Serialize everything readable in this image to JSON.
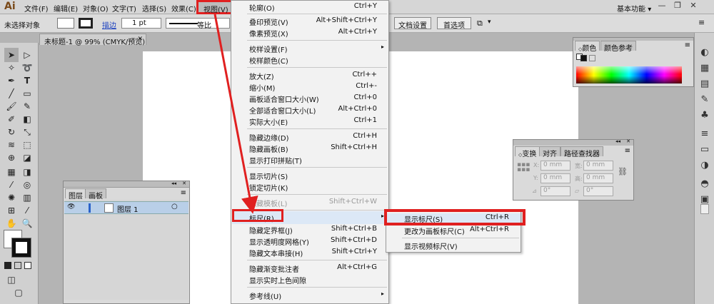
{
  "app": {
    "logo": "Ai",
    "workspace": "基本功能",
    "workspace_arrow": "▾"
  },
  "menubar": {
    "items": [
      {
        "label": "文件(F)"
      },
      {
        "label": "编辑(E)"
      },
      {
        "label": "对象(O)"
      },
      {
        "label": "文字(T)"
      },
      {
        "label": "选择(S)"
      },
      {
        "label": "效果(C)"
      }
    ],
    "view": "视图(V)"
  },
  "window_controls": {
    "minimize": "—",
    "restore": "❐",
    "close": "✕"
  },
  "controlbar": {
    "selection": "未选择对象",
    "stroke_label": "描边",
    "stroke_weight": "1 pt",
    "stroke_profile": "等比",
    "doc_setup": "文档设置",
    "preferences": "首选项"
  },
  "document_tab": {
    "title": "未标题-1 @ 99% (CMYK/预览)",
    "close": "✕"
  },
  "view_menu": {
    "items": [
      {
        "label": "轮廓(O)",
        "shortcut": "Ctrl+Y"
      },
      {
        "label": "叠印预览(V)",
        "shortcut": "Alt+Shift+Ctrl+Y"
      },
      {
        "label": "像素预览(X)",
        "shortcut": "Alt+Ctrl+Y"
      },
      {
        "label": "校样设置(F)",
        "shortcut": "",
        "submenu": true
      },
      {
        "label": "校样颜色(C)",
        "shortcut": ""
      },
      {
        "label": "放大(Z)",
        "shortcut": "Ctrl++"
      },
      {
        "label": "缩小(M)",
        "shortcut": "Ctrl+-"
      },
      {
        "label": "画板适合窗口大小(W)",
        "shortcut": "Ctrl+0"
      },
      {
        "label": "全部适合窗口大小(L)",
        "shortcut": "Alt+Ctrl+0"
      },
      {
        "label": "实际大小(E)",
        "shortcut": "Ctrl+1"
      },
      {
        "label": "隐藏边缘(D)",
        "shortcut": "Ctrl+H"
      },
      {
        "label": "隐藏画板(B)",
        "shortcut": "Shift+Ctrl+H"
      },
      {
        "label": "显示打印拼贴(T)",
        "shortcut": ""
      },
      {
        "label": "显示切片(S)",
        "shortcut": ""
      },
      {
        "label": "锁定切片(K)",
        "shortcut": ""
      },
      {
        "label": "隐藏模板(L)",
        "shortcut": "Shift+Ctrl+W",
        "disabled": true
      },
      {
        "label": "标尺(R)",
        "shortcut": "",
        "submenu": true
      },
      {
        "label": "隐藏定界框(J)",
        "shortcut": "Shift+Ctrl+B"
      },
      {
        "label": "显示透明度网格(Y)",
        "shortcut": "Shift+Ctrl+D"
      },
      {
        "label": "隐藏文本串接(H)",
        "shortcut": "Shift+Ctrl+Y"
      },
      {
        "label": "隐藏渐变批注者",
        "shortcut": "Alt+Ctrl+G"
      },
      {
        "label": "显示实时上色间隙",
        "shortcut": ""
      },
      {
        "label": "参考线(U)",
        "shortcut": "",
        "submenu": true
      }
    ],
    "submenu_arrow": "▸"
  },
  "ruler_submenu": {
    "items": [
      {
        "label": "显示标尺(S)",
        "shortcut": "Ctrl+R"
      },
      {
        "label": "更改为画板标尺(C)",
        "shortcut": "Alt+Ctrl+R"
      },
      {
        "label": "显示视频标尺(V)",
        "shortcut": ""
      }
    ]
  },
  "layers_panel": {
    "tabs": [
      "图层",
      "画板"
    ],
    "layer_name": "图层 1",
    "eye": "👁",
    "target": "○",
    "collapse": "◂◂",
    "close": "✕",
    "menu": "≡"
  },
  "color_panel": {
    "tabs": [
      "颜色",
      "颜色参考"
    ],
    "collapse": "▸▸",
    "close": "✕",
    "menu": "≡"
  },
  "transform_panel": {
    "tabs": [
      "变换",
      "对齐",
      "路径查找器"
    ],
    "x": "0 mm",
    "y": "0 mm",
    "w": "0 mm",
    "h": "0 mm",
    "x_label": "X:",
    "y_label": "Y:",
    "w_label": "宽:",
    "h_label": "高:",
    "angle": "0°",
    "shear": "0°",
    "collapse": "◂◂",
    "close": "✕",
    "menu": "≡"
  },
  "colors": {
    "highlight_red": "#e02020",
    "menu_bg": "#f2f2f2",
    "layer_selected": "#b9cfe8"
  }
}
